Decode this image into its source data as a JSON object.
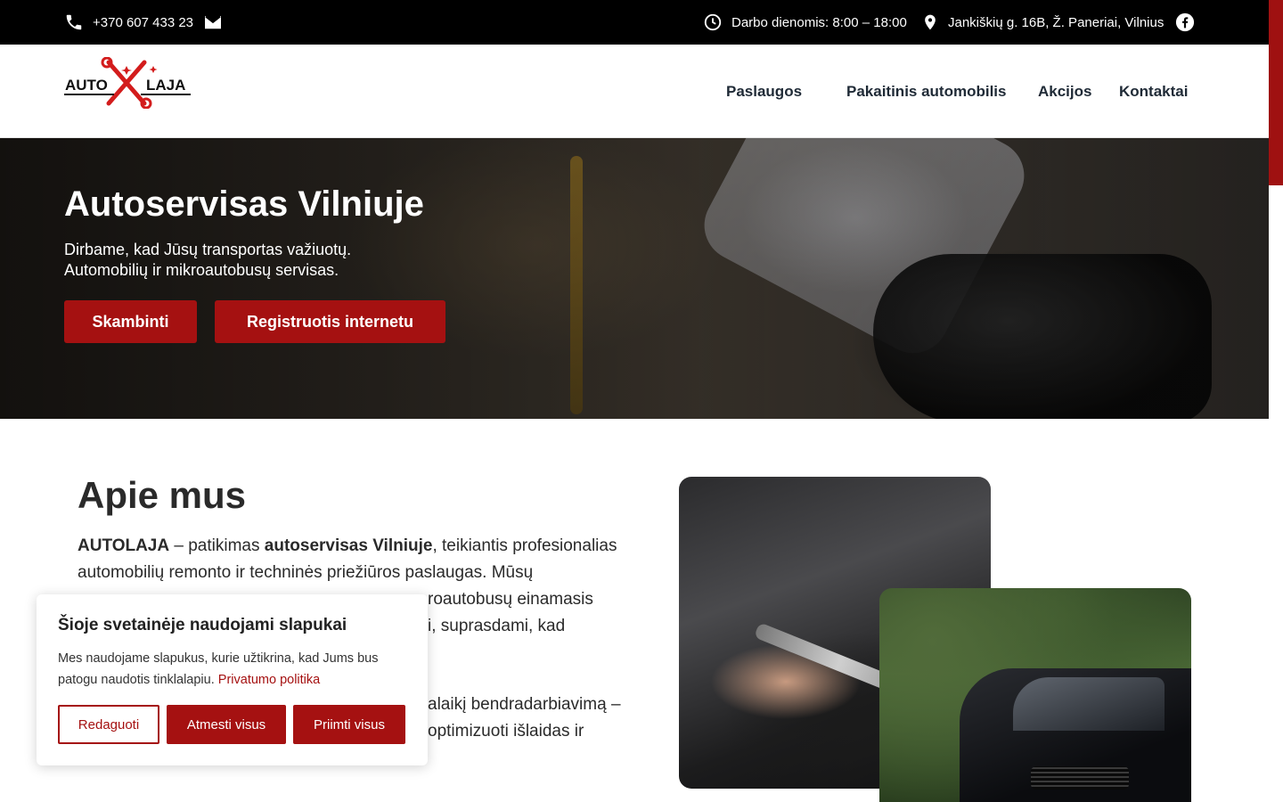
{
  "topbar": {
    "phone": "+370 607 433 23",
    "hours": "Darbo dienomis: 8:00 – 18:00",
    "address": "Jankiškių g. 16B, Ž. Paneriai, Vilnius",
    "icons": [
      "phone-icon",
      "email-icon",
      "clock-icon",
      "location-pin-icon",
      "facebook-icon"
    ]
  },
  "logo": {
    "left": "AUTO",
    "right": "LAJA"
  },
  "nav": {
    "items": [
      {
        "label": "Paslaugos"
      },
      {
        "label": "Pakaitinis automobilis"
      },
      {
        "label": "Akcijos"
      },
      {
        "label": "Kontaktai"
      }
    ]
  },
  "hero": {
    "title": "Autoservisas Vilniuje",
    "subtitle_line1": "Dirbame, kad Jūsų transportas važiuotų.",
    "subtitle_line2": "Automobilių ir mikroautobusų servisas.",
    "button_call": "Skambinti",
    "button_register": "Registruotis internetu"
  },
  "about": {
    "heading": "Apie mus",
    "p1_brand": "AUTOLAJA",
    "p1_mid": " – patikimas ",
    "p1_bold": "autoservisas Vilniuje",
    "p1_rest": ", teikiantis profesionalias automobilių remonto ir techninės priežiūros paslaugas. Mūsų",
    "p1_fragment1": "roautobusų einamasis",
    "p1_fragment2": "i, suprasdami, kad",
    "p2_fragment1": "alaikį bendradarbiavimą –",
    "p2_fragment2": "optimizuoti išlaidas ir"
  },
  "cookie": {
    "title": "Šioje svetainėje naudojami slapukai",
    "text": "Mes naudojame slapukus, kurie užtikrina, kad Jums bus patogu naudotis tinklalapiu.",
    "link": "Privatumo politika",
    "button_edit": "Redaguoti",
    "button_reject": "Atmesti visus",
    "button_accept": "Priimti visus"
  },
  "colors": {
    "accent": "#a51111",
    "topbar_bg": "#000000",
    "nav_text": "#1f2a36"
  }
}
